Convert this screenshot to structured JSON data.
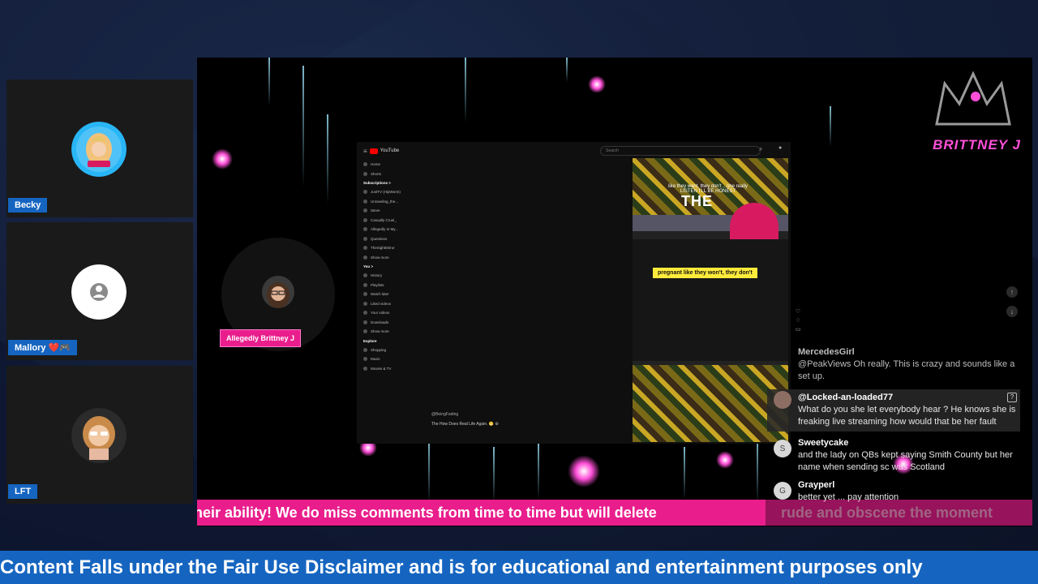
{
  "participants": [
    {
      "name": "Becky",
      "avatar_icon": "profile-photo-icon"
    },
    {
      "name": "Mallory ❤️🎮",
      "avatar_icon": "default-user-icon"
    },
    {
      "name": "LFT",
      "avatar_icon": "profile-photo-icon"
    }
  ],
  "stage": {
    "host_label": "Allegedly Brittney J",
    "brand": "BRITTNEY J",
    "ticker": "heir ability! We do miss comments from time to time but will delete",
    "ticker_tail": "rude and obscene the moment"
  },
  "embedded_browser": {
    "site": "YouTube",
    "search_placeholder": "Search",
    "sidebar": [
      {
        "label": "Home"
      },
      {
        "label": "Shorts"
      },
      {
        "label": "Subscriptions >",
        "header": true
      },
      {
        "label": "JustTV (HipWorm)"
      },
      {
        "label": "Unraveling_the..."
      },
      {
        "label": "Steve"
      },
      {
        "label": "Casually Cruel_"
      },
      {
        "label": "Allegedly In My..."
      },
      {
        "label": "Questions"
      },
      {
        "label": "TheSightMirror"
      },
      {
        "label": "Show more"
      },
      {
        "label": "You >",
        "header": true
      },
      {
        "label": "History"
      },
      {
        "label": "Playlists"
      },
      {
        "label": "Watch later"
      },
      {
        "label": "Liked videos"
      },
      {
        "label": "Your videos"
      },
      {
        "label": "Downloads"
      },
      {
        "label": "Show more"
      },
      {
        "label": "Explore",
        "header": true
      },
      {
        "label": "Shopping"
      },
      {
        "label": "Music"
      },
      {
        "label": "Movies & TV"
      }
    ],
    "video_caption_top": "like they want, they don't ...she really LISTEN I'LL BE HONEST",
    "video_overlay_text": "THE",
    "video_caption": "pregnant like they won't, they don't",
    "channel_name": "@BeingFading",
    "video_title": "The How Does Real Life Again. 😬 ⚙"
  },
  "chat": {
    "messages": [
      {
        "user": "MercedesGirl",
        "text": "@PeakViews Oh really. This is crazy and sounds like a set up.",
        "avatar": "",
        "style": "faded"
      },
      {
        "user": "@Locked-an-loaded77",
        "text": "What do you she let everybody hear ? He knows she is freaking live streaming how would that be her fault",
        "avatar": "",
        "style": "highlight"
      },
      {
        "user": "Sweetycake",
        "text": "and the lady on QBs kept saying Smith County but her name when sending sc was Scotland",
        "avatar": "S",
        "style": "normal"
      },
      {
        "user": "Grayperl",
        "text": "better yet ... pay attention",
        "avatar": "G",
        "style": "normal"
      }
    ]
  },
  "banner": {
    "text": "Content Falls under the Fair Use Disclaimer and is for educational and entertainment purposes only"
  },
  "colors": {
    "accent_blue": "#1565c0",
    "ticker_pink": "#e91e8c",
    "brand_pink": "#ff4fd8"
  }
}
